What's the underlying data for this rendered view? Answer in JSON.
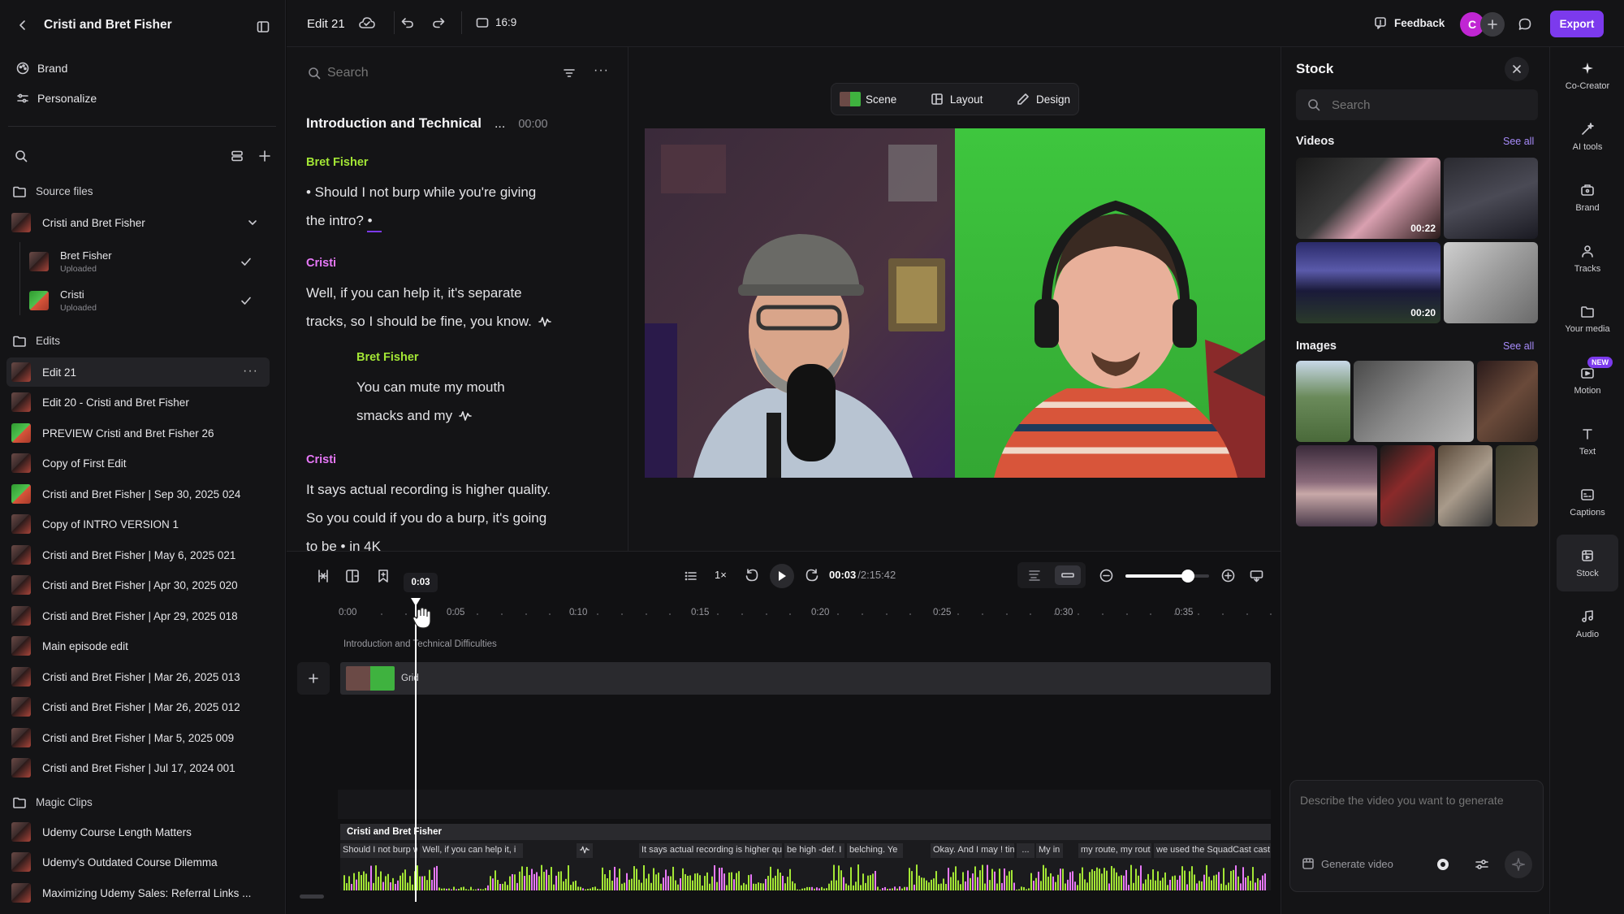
{
  "sidebar": {
    "project_title": "Cristi and Bret Fisher",
    "brand": "Brand",
    "personalize": "Personalize",
    "source_files": "Source files",
    "source_group": "Cristi and Bret Fisher",
    "sources": [
      {
        "name": "Bret Fisher",
        "status": "Uploaded"
      },
      {
        "name": "Cristi",
        "status": "Uploaded"
      }
    ],
    "edits_label": "Edits",
    "edits": [
      "Edit 21",
      "Edit 20 - Cristi and Bret Fisher",
      "PREVIEW Cristi and Bret Fisher 26",
      "Copy of First Edit",
      "Cristi and Bret Fisher | Sep 30, 2025 024",
      "Copy of INTRO VERSION 1",
      "Cristi and Bret Fisher | May 6, 2025 021",
      "Cristi and Bret Fisher | Apr 30, 2025 020",
      "Cristi and Bret Fisher | Apr 29, 2025 018",
      "Main episode edit",
      "Cristi and Bret Fisher | Mar 26, 2025 013",
      "Cristi and Bret Fisher | Mar 26, 2025 012",
      "Cristi and Bret Fisher | Mar 5, 2025 009",
      "Cristi and Bret Fisher | Jul 17, 2024 001"
    ],
    "magic_label": "Magic Clips",
    "magic": [
      "Udemy Course Length Matters",
      "Udemy's Outdated Course Dilemma",
      "Maximizing Udemy Sales: Referral Links ..."
    ]
  },
  "topbar": {
    "edit_name": "Edit 21",
    "aspect": "16:9",
    "feedback": "Feedback",
    "avatar_letter": "C",
    "export": "Export"
  },
  "transcript": {
    "search_placeholder": "Search",
    "section_title": "Introduction and Technical",
    "section_ellipsis": "...",
    "section_time": "00:00",
    "blocks": [
      {
        "speaker": "Bret Fisher",
        "line1": "• Should I not burp while you're giving",
        "line2": "the intro? •"
      },
      {
        "speaker": "Cristi",
        "line1": "Well, if you can help it, it's separate",
        "line2": "tracks, so I should be fine, you know."
      },
      {
        "speaker": "Bret Fisher",
        "line1": "You can mute my mouth",
        "line2": "smacks and my"
      },
      {
        "speaker": "Cristi",
        "line1": "It says actual recording is higher quality.",
        "line2": "So you could if you do a burp, it's going",
        "line3": "to be • in 4K"
      }
    ]
  },
  "preview": {
    "tabs": [
      "Scene",
      "Layout",
      "Design"
    ]
  },
  "timeline": {
    "playhead_label": "0:03",
    "speed": "1×",
    "current_time": "00:03",
    "total_time": "/2:15:42",
    "ticks": [
      "0:00",
      "0:05",
      "0:10",
      "0:15",
      "0:20",
      "0:25",
      "0:30",
      "0:35"
    ],
    "scene_label": "Introduction and Technical Difficulties",
    "layout_clip": "Grid",
    "audio_track": "Cristi and Bret Fisher",
    "transcript_chunks": [
      "Should I not burp wh",
      "Well, if you can help it, i",
      "It says actual recording is higher qu",
      "be high -def. I",
      "belching. Ye",
      "Okay. And I may ! tin",
      "...",
      "My in",
      "my route, my rout",
      "we used the SquadCast cast"
    ],
    "zoom_level": 0.75
  },
  "stock": {
    "title": "Stock",
    "search_placeholder": "Search",
    "videos_label": "Videos",
    "see_all": "See all",
    "video_durations": [
      "00:22",
      "",
      "",
      "00:20"
    ],
    "images_label": "Images",
    "prompt_placeholder": "Describe the video you want to generate",
    "generate": "Generate video"
  },
  "rail": {
    "items": [
      "Co-Creator",
      "AI tools",
      "Brand",
      "Tracks",
      "Your media",
      "Motion",
      "Text",
      "Captions",
      "Stock",
      "Audio"
    ],
    "new_badge": "NEW"
  },
  "colors": {
    "accent": "#7c3aed",
    "bret": "#a3e635",
    "cristi": "#e879f9",
    "waveform_green": "#a3e635",
    "waveform_pink": "#e879f9"
  }
}
